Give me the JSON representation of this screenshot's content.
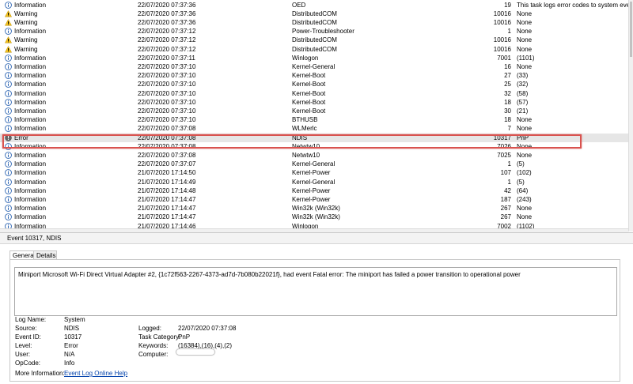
{
  "events": [
    {
      "level": "Information",
      "type": "info",
      "date": "22/07/2020 07:37:36",
      "source": "OED",
      "id": "19",
      "category": "This task logs error codes to system event..."
    },
    {
      "level": "Warning",
      "type": "warning",
      "date": "22/07/2020 07:37:36",
      "source": "DistributedCOM",
      "id": "10016",
      "category": "None"
    },
    {
      "level": "Warning",
      "type": "warning",
      "date": "22/07/2020 07:37:36",
      "source": "DistributedCOM",
      "id": "10016",
      "category": "None"
    },
    {
      "level": "Information",
      "type": "info",
      "date": "22/07/2020 07:37:12",
      "source": "Power-Troubleshooter",
      "id": "1",
      "category": "None"
    },
    {
      "level": "Warning",
      "type": "warning",
      "date": "22/07/2020 07:37:12",
      "source": "DistributedCOM",
      "id": "10016",
      "category": "None"
    },
    {
      "level": "Warning",
      "type": "warning",
      "date": "22/07/2020 07:37:12",
      "source": "DistributedCOM",
      "id": "10016",
      "category": "None"
    },
    {
      "level": "Information",
      "type": "info",
      "date": "22/07/2020 07:37:11",
      "source": "Winlogon",
      "id": "7001",
      "category": "(1101)"
    },
    {
      "level": "Information",
      "type": "info",
      "date": "22/07/2020 07:37:10",
      "source": "Kernel-General",
      "id": "16",
      "category": "None"
    },
    {
      "level": "Information",
      "type": "info",
      "date": "22/07/2020 07:37:10",
      "source": "Kernel-Boot",
      "id": "27",
      "category": "(33)"
    },
    {
      "level": "Information",
      "type": "info",
      "date": "22/07/2020 07:37:10",
      "source": "Kernel-Boot",
      "id": "25",
      "category": "(32)"
    },
    {
      "level": "Information",
      "type": "info",
      "date": "22/07/2020 07:37:10",
      "source": "Kernel-Boot",
      "id": "32",
      "category": "(58)"
    },
    {
      "level": "Information",
      "type": "info",
      "date": "22/07/2020 07:37:10",
      "source": "Kernel-Boot",
      "id": "18",
      "category": "(57)"
    },
    {
      "level": "Information",
      "type": "info",
      "date": "22/07/2020 07:37:10",
      "source": "Kernel-Boot",
      "id": "30",
      "category": "(21)"
    },
    {
      "level": "Information",
      "type": "info",
      "date": "22/07/2020 07:37:10",
      "source": "BTHUSB",
      "id": "18",
      "category": "None"
    },
    {
      "level": "Information",
      "type": "info",
      "date": "22/07/2020 07:37:08",
      "source": "WLMerlc",
      "id": "7",
      "category": "None"
    },
    {
      "level": "Error",
      "type": "error",
      "date": "22/07/2020 07:37:08",
      "source": "NDIS",
      "id": "10317",
      "category": "PnP",
      "selected": true
    },
    {
      "level": "Information",
      "type": "info",
      "date": "22/07/2020 07:37:08",
      "source": "Netwtw10",
      "id": "7026",
      "category": "None"
    },
    {
      "level": "Information",
      "type": "info",
      "date": "22/07/2020 07:37:08",
      "source": "Netwtw10",
      "id": "7025",
      "category": "None"
    },
    {
      "level": "Information",
      "type": "info",
      "date": "22/07/2020 07:37:07",
      "source": "Kernel-General",
      "id": "1",
      "category": "(5)"
    },
    {
      "level": "Information",
      "type": "info",
      "date": "21/07/2020 17:14:50",
      "source": "Kernel-Power",
      "id": "107",
      "category": "(102)"
    },
    {
      "level": "Information",
      "type": "info",
      "date": "21/07/2020 17:14:49",
      "source": "Kernel-General",
      "id": "1",
      "category": "(5)"
    },
    {
      "level": "Information",
      "type": "info",
      "date": "21/07/2020 17:14:48",
      "source": "Kernel-Power",
      "id": "42",
      "category": "(64)"
    },
    {
      "level": "Information",
      "type": "info",
      "date": "21/07/2020 17:14:47",
      "source": "Kernel-Power",
      "id": "187",
      "category": "(243)"
    },
    {
      "level": "Information",
      "type": "info",
      "date": "21/07/2020 17:14:47",
      "source": "Win32k (Win32k)",
      "id": "267",
      "category": "None"
    },
    {
      "level": "Information",
      "type": "info",
      "date": "21/07/2020 17:14:47",
      "source": "Win32k (Win32k)",
      "id": "267",
      "category": "None"
    },
    {
      "level": "Information",
      "type": "info",
      "date": "21/07/2020 17:14:46",
      "source": "Winlogon",
      "id": "7002",
      "category": "(1102)"
    }
  ],
  "detail": {
    "title": "Event 10317, NDIS",
    "tabs": {
      "general": "General",
      "details": "Details"
    },
    "message": "Miniport Microsoft Wi-Fi Direct Virtual Adapter #2, {1c72f563-2267-4373-ad7d-7b080b22021f}, had event Fatal error: The miniport has failed a power transition to operational power",
    "labels": {
      "log_name": "Log Name:",
      "source": "Source:",
      "event_id": "Event ID:",
      "level": "Level:",
      "user": "User:",
      "opcode": "OpCode:",
      "more_info": "More Information:",
      "logged": "Logged:",
      "task_category": "Task Category:",
      "keywords": "Keywords:",
      "computer": "Computer:"
    },
    "values": {
      "log_name": "System",
      "source": "NDIS",
      "event_id": "10317",
      "level": "Error",
      "user": "N/A",
      "opcode": "Info",
      "more_info_link": "Event Log Online Help",
      "logged": "22/07/2020 07:37:08",
      "task_category": "PnP",
      "keywords": "(16384),(16),(4),(2)"
    }
  },
  "colors": {
    "highlight": "#d9534f",
    "info_icon": "#2f66b3",
    "warning_icon": "#f2c01e",
    "error_icon": "#666666",
    "link": "#0645ad"
  }
}
